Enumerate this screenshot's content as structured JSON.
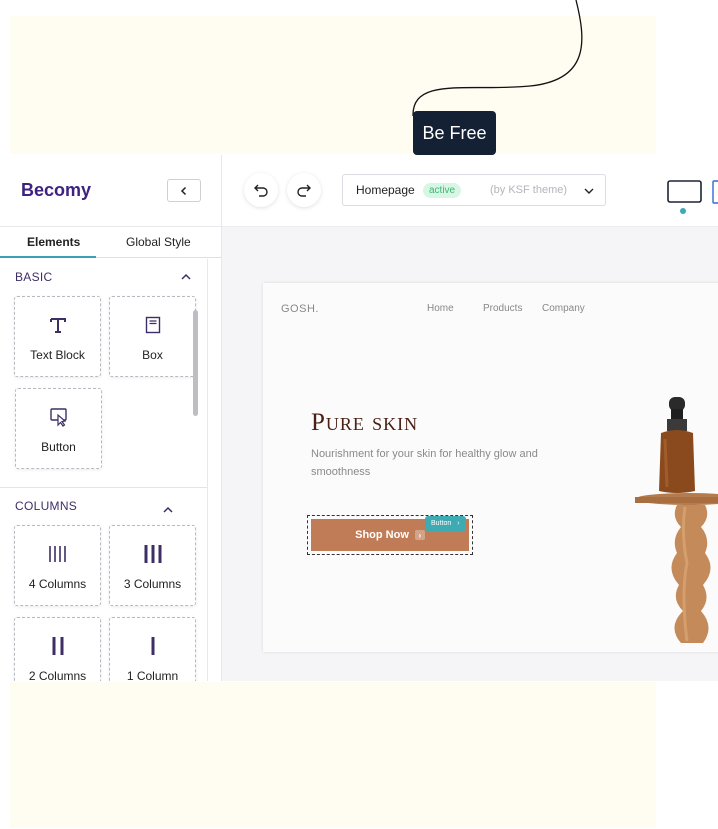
{
  "promo": {
    "label": "Be Free"
  },
  "sidebar": {
    "logo": "Becomy",
    "tabs": [
      {
        "label": "Elements"
      },
      {
        "label": "Global Style"
      }
    ],
    "sections": [
      {
        "title": "BASIC",
        "items": [
          {
            "label": "Text Block",
            "icon": "text-icon"
          },
          {
            "label": "Box",
            "icon": "box-icon"
          },
          {
            "label": "Button",
            "icon": "button-cursor-icon"
          }
        ]
      },
      {
        "title": "COLUMNS",
        "items": [
          {
            "label": "4 Columns",
            "icon": "four-columns-icon"
          },
          {
            "label": "3 Columns",
            "icon": "three-columns-icon"
          },
          {
            "label": "2 Columns",
            "icon": "two-columns-icon"
          },
          {
            "label": "1 Column",
            "icon": "one-column-icon"
          }
        ]
      }
    ]
  },
  "toolbar": {
    "page": {
      "name": "Homepage",
      "status": "active",
      "theme": "(by KSF theme)"
    }
  },
  "site": {
    "brand": "GOSH.",
    "nav": [
      "Home",
      "Products",
      "Company"
    ],
    "hero": {
      "title": "Pure skin",
      "subtitle": "Nourishment for your skin for healthy glow and smoothness",
      "cta": "Shop Now",
      "selected_tag": "Button"
    }
  },
  "colors": {
    "logo": "#3d2183",
    "accent": "#3aa9b8",
    "cta": "#c07c57",
    "dark": "#142033",
    "cream": "#fffcf2"
  }
}
